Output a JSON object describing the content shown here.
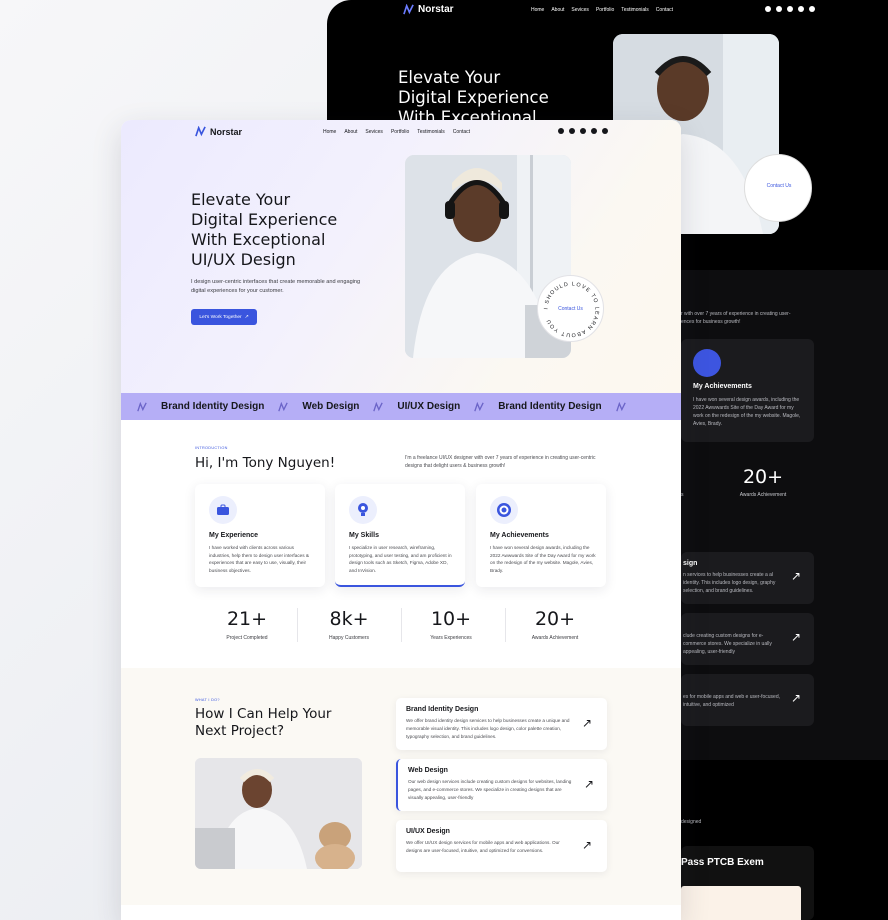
{
  "colors": {
    "accent": "#3a55de",
    "marquee": "#b5aef6",
    "dark_bg": "#000000"
  },
  "brand": {
    "name": "Norstar",
    "icon": "zigzag-logo-icon"
  },
  "nav": {
    "items": [
      "Home",
      "About",
      "Sevices",
      "Portfolio",
      "Testimonials",
      "Contact"
    ]
  },
  "social": [
    "facebook-icon",
    "twitter-icon",
    "dribbble-icon",
    "behance-icon",
    "pinterest-icon"
  ],
  "dark": {
    "title_line1": "Elevate Your",
    "title_line2": "Digital Experience",
    "title_line3": "With Exceptional",
    "contact_badge": "Contact Us",
    "intro_snippet_1": "r with over 7 years of experience in creating user-",
    "intro_snippet_2": "ences for business growth!",
    "achievements_title": "My Achievements",
    "achievements_text": "I have won several design awards, including the 2022 Awwwards Site of the Day Award for my work on the redesign of the my website. Magole, Avies, Brady.",
    "stat_num": "20+",
    "stat_lbl": "Awards Achievement",
    "stat_fragment": "s",
    "svc1_head": "sign",
    "svc1_text": "n services to help businesses create a al identity. This includes logo design, graphy selection, and brand guidelines.",
    "svc2_text": "clude creating custom designs for e-commerce stores. We specialize in ually appealing, user-friendly",
    "svc3_text": "es for mobile apps and web e user-focused, intuitive, and optimized",
    "designed": "designed",
    "ptcb": "Pass PTCB Exem"
  },
  "hero": {
    "title_line1": "Elevate Your",
    "title_line2": "Digital Experience",
    "title_line3": "With Exceptional",
    "title_line4": "UI/UX Design",
    "description": "I design user-centric interfaces that create memorable and engaging digital experiences for your customer.",
    "cta_label": "Let's Work Together",
    "badge_ring": "I SHOULD LOVE TO LEARN ABOUT YOU",
    "badge_center": "Contact Us"
  },
  "marquee": [
    "Brand Identity Design",
    "Web Design",
    "UI/UX Design",
    "Brand Identity Design"
  ],
  "intro": {
    "eyebrow": "INTRODUCTION",
    "title": "Hi, I'm Tony Nguyen!",
    "description": "I'm a freelance UI/UX designer with over 7 years of experience in creating user-centric designs that delight users & business growth!"
  },
  "features": [
    {
      "title": "My Experience",
      "icon": "briefcase-icon",
      "text": "I have worked with clients across various industries, help them to design user interfaces & experiences that are easy to use, visually, their business objectives."
    },
    {
      "title": "My Skills",
      "icon": "lightbulb-icon",
      "text": "I specialize in user research, wireframing, prototyping, and user testing, and am proficient in design tools such as Sketch, Figma, Adobe XD, and InVision."
    },
    {
      "title": "My Achievements",
      "icon": "target-icon",
      "text": "I have won several design awards, including the 2022 Awwwards Site of the Day Award for my work on the redesign of the my website. Magole, Avies, Brady."
    }
  ],
  "stats": [
    {
      "num": "21+",
      "label": "Project Completed"
    },
    {
      "num": "8k+",
      "label": "Happy Customers"
    },
    {
      "num": "10+",
      "label": "Years Experiences"
    },
    {
      "num": "20+",
      "label": "Awards Achievement"
    }
  ],
  "services": {
    "eyebrow": "WHAT I DO?",
    "title": "How I Can Help Your Next Project?",
    "items": [
      {
        "title": "Brand Identity Design",
        "text": "We offer brand identity design services to help businesses create a unique and memorable visual identity. This includes logo design, color palette creation, typography selection, and brand guidelines."
      },
      {
        "title": "Web Design",
        "text": "Our web design services include creating custom designs for websites, landing pages, and e-commerce stores. We specialize in creating designs that are visually appealing, user-friendly"
      },
      {
        "title": "UI/UX Design",
        "text": "We offer UI/UX design services for mobile apps and web applications. Our designs are user-focused, intuitive, and optimized for conversions."
      }
    ]
  }
}
